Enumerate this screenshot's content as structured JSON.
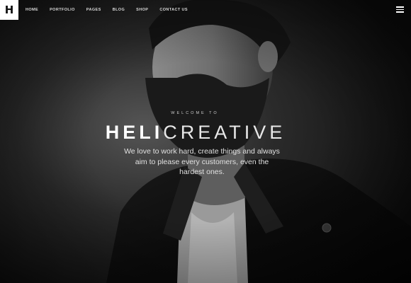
{
  "logo": {
    "letter": "H"
  },
  "nav": {
    "items": [
      {
        "label": "HOME"
      },
      {
        "label": "PORTFOLIO"
      },
      {
        "label": "PAGES"
      },
      {
        "label": "BLOG"
      },
      {
        "label": "SHOP"
      },
      {
        "label": "CONTACT US"
      }
    ],
    "menu_icon": "hamburger-menu-icon"
  },
  "hero": {
    "welcome": "WELCOME TO",
    "headline_bold": "HELI",
    "headline_light": "CREATIVE",
    "tagline": "We love to work hard, create things and always aim to please every customers, even the hardest ones."
  },
  "colors": {
    "text": "#ffffff",
    "background": "#111111",
    "logo_bg": "#ffffff"
  }
}
